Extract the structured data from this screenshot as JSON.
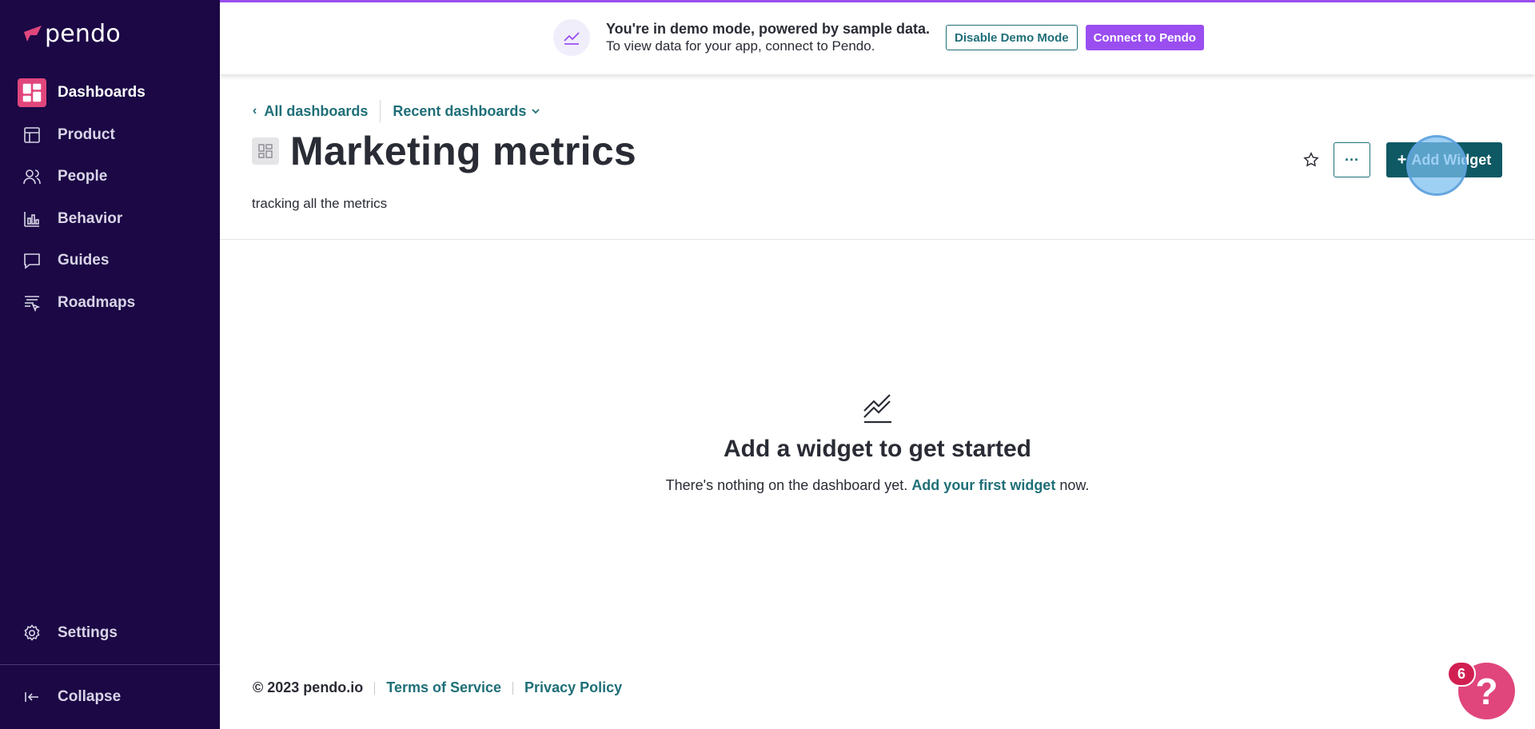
{
  "app": {
    "logo_text": "pendo",
    "brand_color": "#e0467c",
    "sidebar_bg": "#1b0845"
  },
  "sidebar": {
    "items": [
      {
        "label": "Dashboards",
        "icon": "dashboard-icon",
        "active": true
      },
      {
        "label": "Product",
        "icon": "layout-icon"
      },
      {
        "label": "People",
        "icon": "people-icon"
      },
      {
        "label": "Behavior",
        "icon": "bar-chart-icon"
      },
      {
        "label": "Guides",
        "icon": "message-icon"
      },
      {
        "label": "Roadmaps",
        "icon": "roadmap-icon"
      }
    ],
    "settings_label": "Settings",
    "collapse_label": "Collapse"
  },
  "banner": {
    "title": "You're in demo mode, powered by sample data.",
    "subtitle": "To view data for your app, connect to Pendo.",
    "disable_label": "Disable Demo Mode",
    "connect_label": "Connect to Pendo"
  },
  "header": {
    "back_label": "All dashboards",
    "recent_label": "Recent dashboards",
    "title": "Marketing metrics",
    "description": "tracking all the metrics",
    "more_label": "···",
    "add_label": "Add Widget",
    "add_plus": "+"
  },
  "empty_state": {
    "title": "Add a widget to get started",
    "text_before": "There's nothing on the dashboard yet. ",
    "link": "Add your first widget",
    "text_after": " now."
  },
  "footer": {
    "copyright": "© 2023 pendo.io",
    "terms": "Terms of Service",
    "privacy": "Privacy Policy"
  },
  "help": {
    "symbol": "?",
    "badge_count": "6"
  }
}
